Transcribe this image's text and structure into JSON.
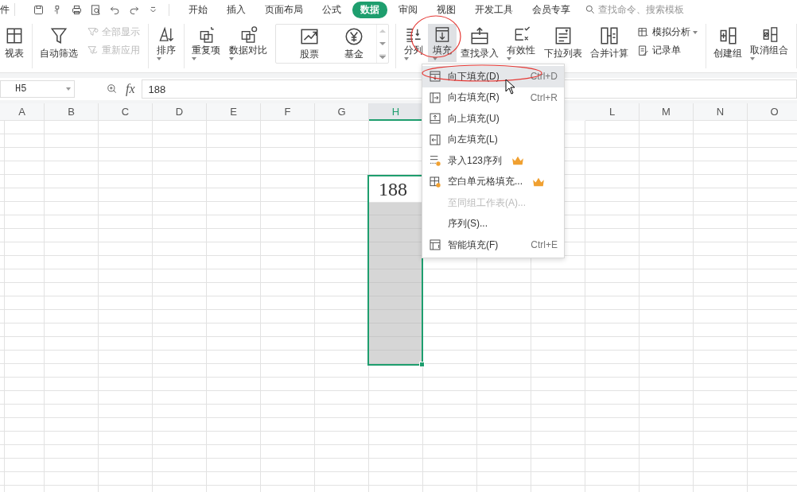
{
  "menu_bar": {
    "file_label": "件",
    "tabs": [
      {
        "label": "开始",
        "selected": false
      },
      {
        "label": "插入",
        "selected": false
      },
      {
        "label": "页面布局",
        "selected": false
      },
      {
        "label": "公式",
        "selected": false
      },
      {
        "label": "数据",
        "selected": true
      },
      {
        "label": "审阅",
        "selected": false
      },
      {
        "label": "视图",
        "selected": false
      },
      {
        "label": "开发工具",
        "selected": false
      },
      {
        "label": "会员专享",
        "selected": false
      }
    ],
    "search": {
      "placeholder": "查找命令、搜索模板"
    }
  },
  "ribbon": {
    "groups": [
      {
        "items": [
          {
            "kind": "big",
            "label": "视表",
            "dropdown": false,
            "pressed": false
          }
        ]
      },
      {
        "items": [
          {
            "kind": "big",
            "label": "自动筛选",
            "dropdown": false,
            "pressed": false
          },
          {
            "kind": "stack",
            "entries": [
              {
                "label": "全部显示",
                "disabled": true,
                "dropdown": false
              },
              {
                "label": "重新应用",
                "disabled": true,
                "dropdown": false
              }
            ]
          }
        ]
      },
      {
        "items": [
          {
            "kind": "big",
            "label": "排序",
            "dropdown": true,
            "pressed": false
          }
        ]
      },
      {
        "items": [
          {
            "kind": "big",
            "label": "重复项",
            "dropdown": true,
            "pressed": false
          },
          {
            "kind": "big",
            "label": "数据对比",
            "dropdown": true,
            "pressed": false
          },
          {
            "kind": "gallery",
            "entries": [
              {
                "label": "股票"
              },
              {
                "label": "基金"
              }
            ]
          }
        ]
      },
      {
        "items": [
          {
            "kind": "big",
            "label": "分列",
            "dropdown": true,
            "pressed": false
          },
          {
            "kind": "big",
            "label": "填充",
            "dropdown": true,
            "pressed": true
          },
          {
            "kind": "big",
            "label": "查找录入",
            "dropdown": false,
            "pressed": false
          },
          {
            "kind": "big",
            "label": "有效性",
            "dropdown": true,
            "pressed": false
          },
          {
            "kind": "big",
            "label": "下拉列表",
            "dropdown": false,
            "pressed": false
          },
          {
            "kind": "big",
            "label": "合并计算",
            "dropdown": false,
            "pressed": false
          },
          {
            "kind": "stack",
            "entries": [
              {
                "label": "模拟分析",
                "disabled": false,
                "dropdown": true
              },
              {
                "label": "记录单",
                "disabled": false,
                "dropdown": false
              }
            ]
          }
        ]
      },
      {
        "items": [
          {
            "kind": "big",
            "label": "创建组",
            "dropdown": false,
            "pressed": false
          },
          {
            "kind": "big",
            "label": "取消组合",
            "dropdown": true,
            "pressed": false
          }
        ]
      }
    ]
  },
  "formula_bar": {
    "name_box": "H5",
    "fx_label": "fx",
    "value": "188"
  },
  "sheet": {
    "columns_left": [
      {
        "label": "A",
        "selected": false
      },
      {
        "label": "B",
        "selected": false
      },
      {
        "label": "C",
        "selected": false
      },
      {
        "label": "D",
        "selected": false
      },
      {
        "label": "E",
        "selected": false
      },
      {
        "label": "F",
        "selected": false
      },
      {
        "label": "G",
        "selected": false
      },
      {
        "label": "H",
        "selected": true
      }
    ],
    "columns_right": [
      {
        "label": "L",
        "selected": false
      },
      {
        "label": "M",
        "selected": false
      },
      {
        "label": "N",
        "selected": false
      },
      {
        "label": "O",
        "selected": false
      }
    ],
    "cell_value": "188"
  },
  "fill_menu": {
    "items": [
      {
        "label": "向下填充(D)",
        "shortcut": "Ctrl+D",
        "selected": true,
        "disabled": false,
        "premium": false
      },
      {
        "label": "向右填充(R)",
        "shortcut": "Ctrl+R",
        "selected": false,
        "disabled": false,
        "premium": false
      },
      {
        "label": "向上填充(U)",
        "selected": false,
        "disabled": false,
        "premium": false
      },
      {
        "label": "向左填充(L)",
        "selected": false,
        "disabled": false,
        "premium": false
      },
      {
        "label": "录入123序列",
        "selected": false,
        "disabled": false,
        "premium": true
      },
      {
        "label": "空白单元格填充...",
        "selected": false,
        "disabled": false,
        "premium": true
      },
      {
        "label": "至同组工作表(A)...",
        "selected": false,
        "disabled": true,
        "premium": false
      },
      {
        "label": "序列(S)...",
        "selected": false,
        "disabled": false,
        "premium": false
      },
      {
        "label": "智能填充(F)",
        "shortcut": "Ctrl+E",
        "selected": false,
        "disabled": false,
        "premium": false
      }
    ]
  }
}
